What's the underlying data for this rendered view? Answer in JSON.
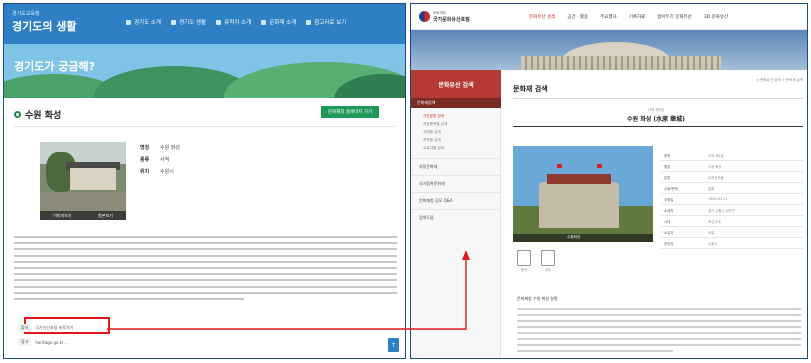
{
  "left": {
    "header": {
      "small_text": "경기도교육청",
      "logo": "경기도의 생활",
      "nav": [
        "경기도 소개",
        "경기도 생활",
        "유적지 소개",
        "문화재 소개",
        "참고자료 보기"
      ]
    },
    "hero": {
      "text": "경기도가 궁금해?"
    },
    "page": {
      "title": "수원 화성",
      "action_button": "문화재청 홈페이지 가기",
      "photo_caption_1": "이미지보기",
      "photo_caption_2": "원본보기",
      "info": [
        {
          "label": "명칭",
          "value": "수원 화성"
        },
        {
          "label": "종류",
          "value": "사적"
        },
        {
          "label": "위치",
          "value": "수원시"
        }
      ],
      "source_label": "출처",
      "source_value": "국가유산포털 바로가기",
      "source2_label": "참고",
      "source2_value": "heritage.go.kr ...",
      "fab_icon": "arrow-up-icon"
    }
  },
  "right": {
    "top": {
      "org_small": "문화재청",
      "org": "국가문화유산포털",
      "nav": [
        "문화유산 검색",
        "공간 · 활용",
        "주요행사",
        "기록자료",
        "알아두기 문화유산",
        "3D 문화유산"
      ],
      "active_nav": 0
    },
    "sidebar": {
      "title": "문화유산 검색",
      "sub": "문화재검색",
      "items": [
        "기간분류 검색",
        "지정종목별 검색",
        "시대별 검색",
        "지역별 검색",
        "소유자별 검색"
      ],
      "main_links": [
        "지정문화재",
        "국가등록문화재",
        "문화재청 공모 Q&A",
        "검색도움"
      ]
    },
    "content": {
      "page_title": "문화재 검색",
      "breadcrumb": "> 문화유산 검색 > 문화재 검색",
      "item_small": "사적 제3호",
      "item_title": "수원 화성 (水原 華城)",
      "photo_caption": "수원화성",
      "table": [
        {
          "th": "종목",
          "td": "사적 제3호"
        },
        {
          "th": "명칭",
          "td": "수원 화성"
        },
        {
          "th": "분류",
          "td": "유적건조물"
        },
        {
          "th": "수량/면적",
          "td": "일원"
        },
        {
          "th": "지정일",
          "td": "1963.01.21"
        },
        {
          "th": "소재지",
          "td": "경기 수원시 장안구"
        },
        {
          "th": "시대",
          "td": "조선시대"
        },
        {
          "th": "소유자",
          "td": "국유"
        },
        {
          "th": "관리자",
          "td": "수원시"
        }
      ],
      "icons": [
        {
          "name": "document-icon",
          "caption": "문서"
        },
        {
          "name": "map-icon",
          "caption": "지도"
        }
      ],
      "desc_head": "문화재청 수원 화성 설명"
    }
  },
  "connector": {
    "color": "#e01818"
  }
}
